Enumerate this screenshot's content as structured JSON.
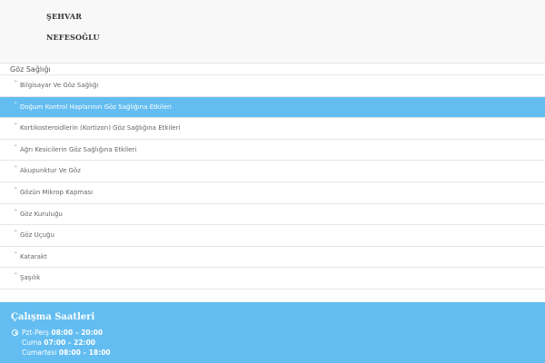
{
  "header": {
    "brand_line_1": "ŞEHVAR",
    "brand_line_2": "NEFESOĞLU"
  },
  "section": {
    "title": "Göz Sağlığı"
  },
  "topics": [
    {
      "bullet": "\"",
      "label": "Bilgisayar Ve Göz Sağlığı",
      "active": false
    },
    {
      "bullet": "\"",
      "label": "Doğum Kontrol Haplarının Göz Sağlığına Etkileri",
      "active": true
    },
    {
      "bullet": "\"",
      "label": "Kortikosteroidlerin (Kortizon) Göz Sağlığına Etkileri",
      "active": false
    },
    {
      "bullet": "\"",
      "label": "Ağrı Kesicilerin Göz Sağlığına Etkileri",
      "active": false
    },
    {
      "bullet": "\"",
      "label": "Akupunktur Ve Göz",
      "active": false
    },
    {
      "bullet": "\"",
      "label": "Gözün Mikrop Kapması",
      "active": false
    },
    {
      "bullet": "\"",
      "label": "Göz Kuruluğu",
      "active": false
    },
    {
      "bullet": "\"",
      "label": "Göz Uçuğu",
      "active": false
    },
    {
      "bullet": "\"",
      "label": "Katarakt",
      "active": false
    },
    {
      "bullet": "\"",
      "label": "Şaşılık",
      "active": false
    }
  ],
  "hours": {
    "title": "Çalışma Saatleri",
    "icon": "clock-icon",
    "rows": [
      {
        "day": "Pzt-Perş",
        "time": "08:00 – 20:00"
      },
      {
        "day": "Cuma",
        "time": "07:00 – 22:00"
      },
      {
        "day": "Cumartesi",
        "time": "08:00 – 18:00"
      }
    ]
  },
  "colors": {
    "accent": "#63bdf1",
    "header_bg": "#f8f8f8",
    "text": "#666666"
  }
}
